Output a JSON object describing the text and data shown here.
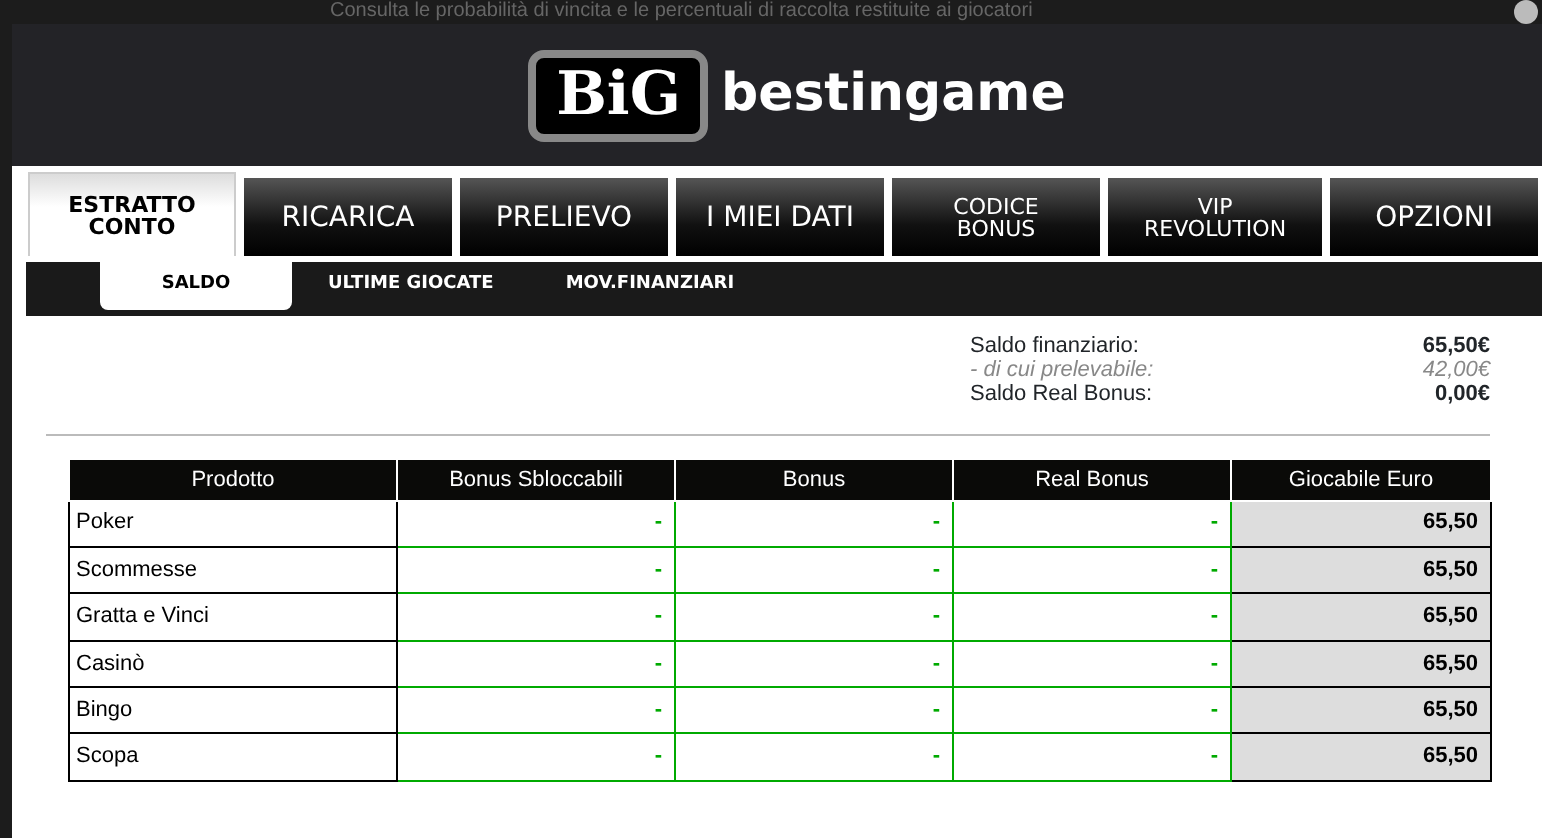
{
  "background_text": "Consulta le probabilità di vincita e le percentuali di raccolta restituite ai giocatori",
  "logo": {
    "badge": "BiG",
    "name": "bestingame"
  },
  "tabs": [
    {
      "label": "ESTRATTO CONTO",
      "selected": true
    },
    {
      "label": "RICARICA",
      "selected": false
    },
    {
      "label": "PRELIEVO",
      "selected": false
    },
    {
      "label": "I MIEI DATI",
      "selected": false
    },
    {
      "label": "CODICE BONUS",
      "selected": false
    },
    {
      "label": "VIP REVOLUTION",
      "selected": false
    },
    {
      "label": "OPZIONI",
      "selected": false
    }
  ],
  "subtabs": [
    {
      "label": "SALDO",
      "selected": true
    },
    {
      "label": "ULTIME GIOCATE",
      "selected": false
    },
    {
      "label": "MOV.FINANZIARI",
      "selected": false
    }
  ],
  "summary": [
    {
      "label": "Saldo finanziario:",
      "value": "65,50€",
      "kind": "main"
    },
    {
      "label": "- di cui prelevabile:",
      "value": "42,00€",
      "kind": "sub"
    },
    {
      "label": "Saldo Real Bonus:",
      "value": "0,00€",
      "kind": "main"
    }
  ],
  "table": {
    "columns": [
      "Prodotto",
      "Bonus Sbloccabili",
      "Bonus",
      "Real Bonus",
      "Giocabile Euro"
    ],
    "rows": [
      [
        "Poker",
        "-",
        "-",
        "-",
        "65,50"
      ],
      [
        "Scommesse",
        "-",
        "-",
        "-",
        "65,50"
      ],
      [
        "Gratta e Vinci",
        "-",
        "-",
        "-",
        "65,50"
      ],
      [
        "Casinò",
        "-",
        "-",
        "-",
        "65,50"
      ],
      [
        "Bingo",
        "-",
        "-",
        "-",
        "65,50"
      ],
      [
        "Scopa",
        "-",
        "-",
        "-",
        "65,50"
      ]
    ]
  }
}
